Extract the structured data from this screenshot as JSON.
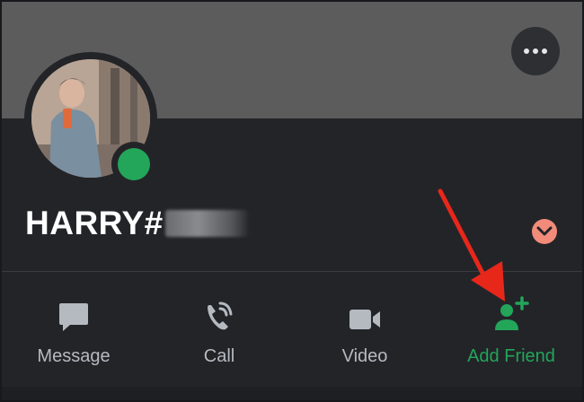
{
  "profile": {
    "username_visible": "HARRY#",
    "status": "online",
    "status_color": "#23a55a"
  },
  "actions": [
    {
      "label": "Message",
      "icon": "message-bubble-icon"
    },
    {
      "label": "Call",
      "icon": "phone-call-icon"
    },
    {
      "label": "Video",
      "icon": "video-camera-icon"
    },
    {
      "label": "Add Friend",
      "icon": "add-friend-icon"
    }
  ],
  "colors": {
    "banner": "#5b5c5b",
    "card": "#232428",
    "accent_green": "#23a55a",
    "badge": "#f28b7a",
    "annotation_arrow": "#e8271b"
  }
}
